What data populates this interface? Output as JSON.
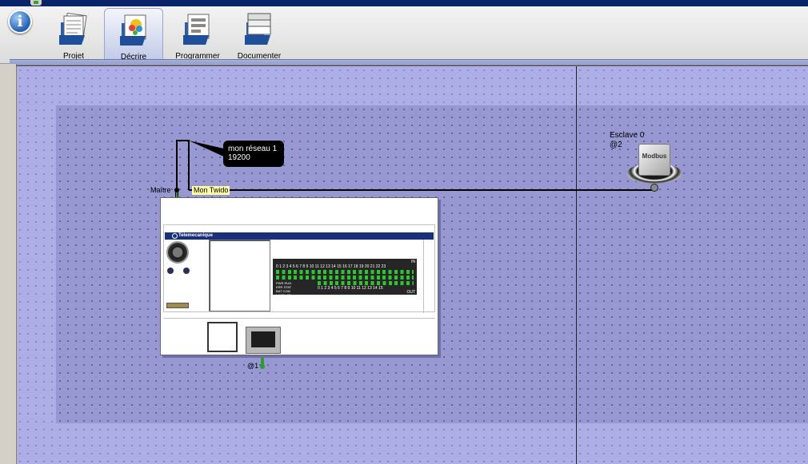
{
  "toolbar": {
    "info_icon": "info-icon",
    "tabs": [
      {
        "label": "Projet",
        "icon": "project-icon"
      },
      {
        "label": "Décrire",
        "icon": "describe-icon"
      },
      {
        "label": "Programmer",
        "icon": "program-icon"
      },
      {
        "label": "Documenter",
        "icon": "document-icon"
      }
    ],
    "active_tab": "Décrire"
  },
  "network": {
    "name": "mon réseau 1",
    "baud": "19200",
    "master_label": "Maître",
    "controller_name": "Mon Twido"
  },
  "controller": {
    "brand": "Telemecanique",
    "in_label": "IN",
    "out_label": "OUT",
    "inputs": "0 1 2 3 4 5 6 7 8 9 10 11 12 13 14 15 16 17 18 19 20 21 22 23",
    "outputs": "0 1 2 3 4 5 6 7 8 9 10 11 12 13 14 15",
    "status_leds": [
      "PWR",
      "RUN",
      "ERR",
      "STAT",
      "BAT",
      "COM",
      "LACT",
      "LST"
    ],
    "address": "@1"
  },
  "slave": {
    "name": "Esclave 0",
    "address": "@2",
    "type": "Modbus"
  },
  "colors": {
    "canvas": "#aeaee6",
    "zone": "#9797d2",
    "plc_brand_bar": "#1a2f7a",
    "led_green": "#2ec52e",
    "link_green": "#2f9e2f"
  }
}
